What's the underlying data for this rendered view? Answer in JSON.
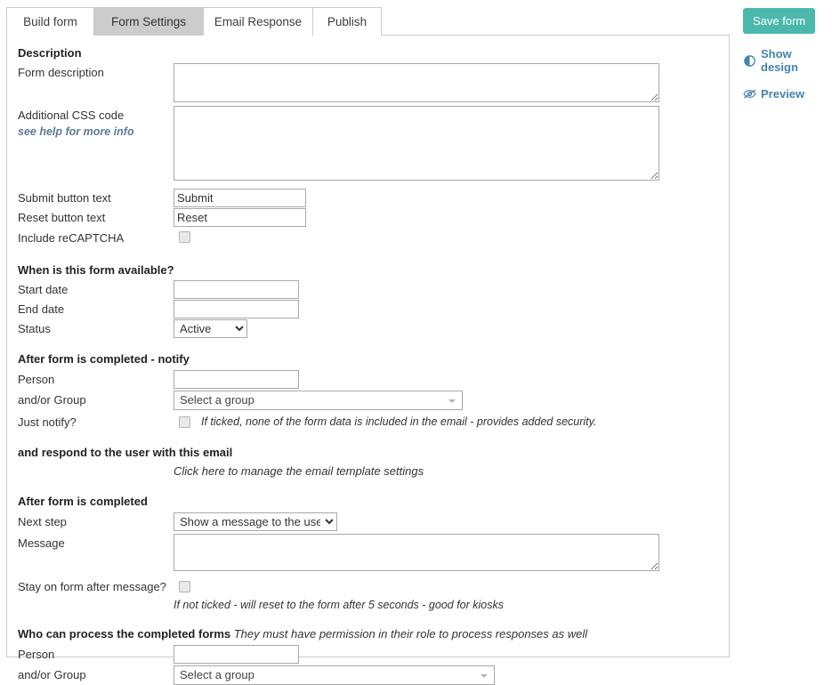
{
  "tabs": [
    {
      "label": "Build form",
      "active": false
    },
    {
      "label": "Form Settings",
      "active": true
    },
    {
      "label": "Email Response",
      "active": false
    },
    {
      "label": "Publish",
      "active": false
    }
  ],
  "rail": {
    "save_label": "Save form",
    "save_color": "#4cb8ab",
    "link_color": "#4484ad",
    "show_design_label": "Show design",
    "show_design_icon": "contrast-icon",
    "preview_label": "Preview",
    "preview_icon": "eye-slash-icon"
  },
  "sections": {
    "description": {
      "heading": "Description",
      "form_description_label": "Form description",
      "form_description_value": "",
      "css_label": "Additional CSS code",
      "css_help_link": "see help for more info",
      "css_value": "",
      "submit_label": "Submit button text",
      "submit_value": "Submit",
      "reset_label": "Reset button text",
      "reset_value": "Reset",
      "recaptcha_label": "Include reCAPTCHA",
      "recaptcha_checked": false
    },
    "availability": {
      "heading": "When is this form available?",
      "start_label": "Start date",
      "start_value": "",
      "end_label": "End date",
      "end_value": "",
      "status_label": "Status",
      "status_value": "Active",
      "status_options": [
        "Active"
      ]
    },
    "notify": {
      "heading": "After form is completed - notify",
      "person_label": "Person",
      "person_value": "",
      "group_label": "and/or Group",
      "group_value": "Select a group",
      "just_notify_label": "Just notify?",
      "just_notify_checked": false,
      "just_notify_hint": "If ticked, none of the form data is included in the email - provides added security."
    },
    "respond": {
      "heading": "and respond to the user with this email",
      "template_link": "Click here to manage the email template settings"
    },
    "completed": {
      "heading": "After form is completed",
      "next_step_label": "Next step",
      "next_step_value": "Show a message to the user",
      "next_step_options": [
        "Show a message to the user"
      ],
      "message_label": "Message",
      "message_value": "",
      "stay_label": "Stay on form after message?",
      "stay_checked": false,
      "stay_hint": "If not ticked - will reset to the form after 5 seconds - good for kiosks"
    },
    "process": {
      "heading": "Who can process the completed forms",
      "heading_note": "They must have permission in their role to process responses as well",
      "person_label": "Person",
      "person_value": "",
      "group_label": "and/or Group",
      "group_value": "Select a group"
    }
  }
}
